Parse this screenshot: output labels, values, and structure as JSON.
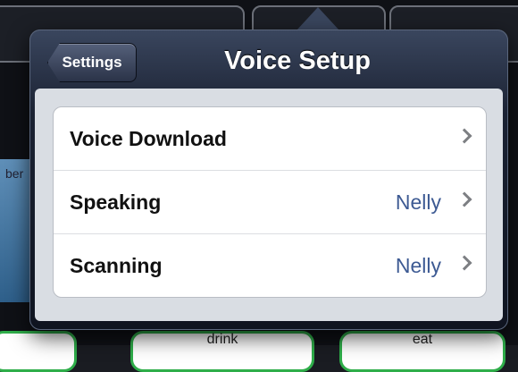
{
  "background": {
    "side_tile_label": "ber",
    "bottom_tiles": [
      "drink",
      "eat"
    ]
  },
  "popover": {
    "back_label": "Settings",
    "title": "Voice Setup",
    "rows": [
      {
        "label": "Voice Download",
        "value": ""
      },
      {
        "label": "Speaking",
        "value": "Nelly"
      },
      {
        "label": "Scanning",
        "value": "Nelly"
      }
    ]
  },
  "colors": {
    "value_text": "#3d5a93",
    "bottom_tile_border": "#2fae4a"
  },
  "icons": [
    "back-arrow-icon",
    "chevron-right-icon"
  ]
}
